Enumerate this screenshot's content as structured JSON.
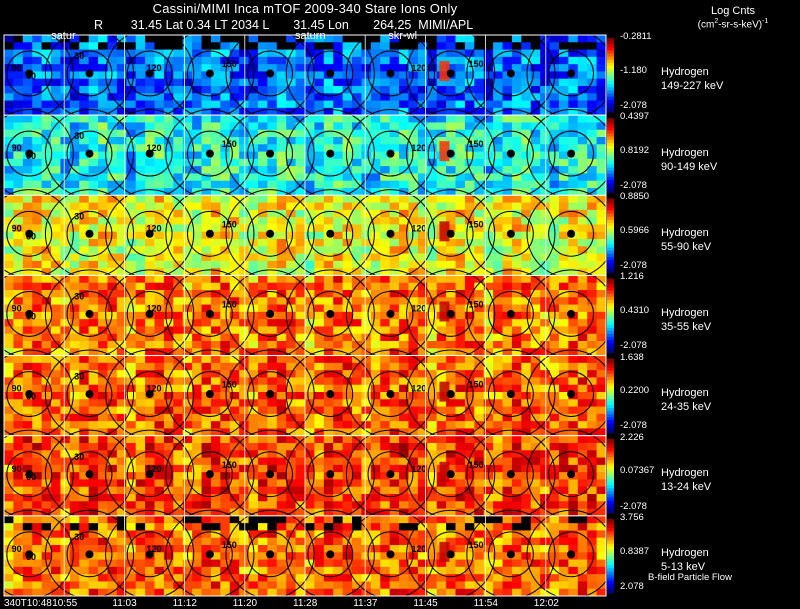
{
  "header": {
    "title": "Cassini/MIMI Inca mTOF  2009-340   Stare    Ions Only",
    "info": "R        31.45 Lat 0.34 LT 2034 L       31.45 Lon       264.25  MIMI/APL"
  },
  "colorbar": {
    "title": "Log Cnts",
    "units_main": "(cm",
    "units_sup1": "2",
    "units_mid": "-sr-s-keV)",
    "units_sup2": "-1"
  },
  "colors": {
    "background": "#000000",
    "grid": "#ffffff",
    "contour": "#000000"
  },
  "footer_note": "B-field Particle Flow",
  "chart_data": {
    "type": "heatmap",
    "time_labels": [
      "340T10:48",
      "10:55",
      "11:03",
      "11:12",
      "11:20",
      "11:28",
      "11:37",
      "11:45",
      "11:54",
      "12:02"
    ],
    "overlay_labels": [
      "satur",
      "saturn",
      "skr-wl"
    ],
    "contour_labels": [
      "30",
      "60",
      "90",
      "120",
      "150",
      "120",
      "150"
    ],
    "panels": [
      {
        "species": "Hydrogen",
        "energy": "149-227 keV",
        "cmax": "-0.2811",
        "cmid": "-1.180",
        "cmin": "-2.078",
        "level": 0.25
      },
      {
        "species": "Hydrogen",
        "energy": "90-149 keV",
        "cmax": "0.4397",
        "cmid": "0.8192",
        "cmin": "-2.078",
        "level": 0.42
      },
      {
        "species": "Hydrogen",
        "energy": "55-90 keV",
        "cmax": "0.8850",
        "cmid": "0.5966",
        "cmin": "-2.078",
        "level": 0.64
      },
      {
        "species": "Hydrogen",
        "energy": "35-55 keV",
        "cmax": "1.216",
        "cmid": "0.4310",
        "cmin": "-2.078",
        "level": 0.78
      },
      {
        "species": "Hydrogen",
        "energy": "24-35 keV",
        "cmax": "1.638",
        "cmid": "0.2200",
        "cmin": "-2.078",
        "level": 0.8
      },
      {
        "species": "Hydrogen",
        "energy": "13-24 keV",
        "cmax": "2.226",
        "cmid": "0.07367",
        "cmin": "-2.078",
        "level": 0.84
      },
      {
        "species": "Hydrogen",
        "energy": "5-13 keV",
        "cmax": "3.756",
        "cmid": "0.8387",
        "cmin": "2.078",
        "level": 0.8
      }
    ]
  }
}
